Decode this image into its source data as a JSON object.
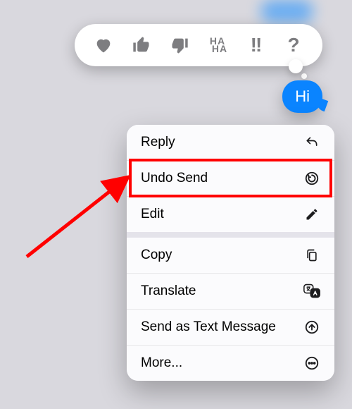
{
  "message": {
    "text": "Hi"
  },
  "tapbacks": {
    "heart": "heart-icon",
    "thumbs_up": "thumbs-up-icon",
    "thumbs_down": "thumbs-down-icon",
    "haha_top": "HA",
    "haha_bottom": "HA",
    "exclaim": "!!",
    "question": "?"
  },
  "menu": {
    "reply": "Reply",
    "undo_send": "Undo Send",
    "edit": "Edit",
    "copy": "Copy",
    "translate": "Translate",
    "send_as_text": "Send as Text Message",
    "more": "More..."
  },
  "annotation": {
    "highlight_target": "undo-send",
    "arrow_color": "#ff0000"
  }
}
